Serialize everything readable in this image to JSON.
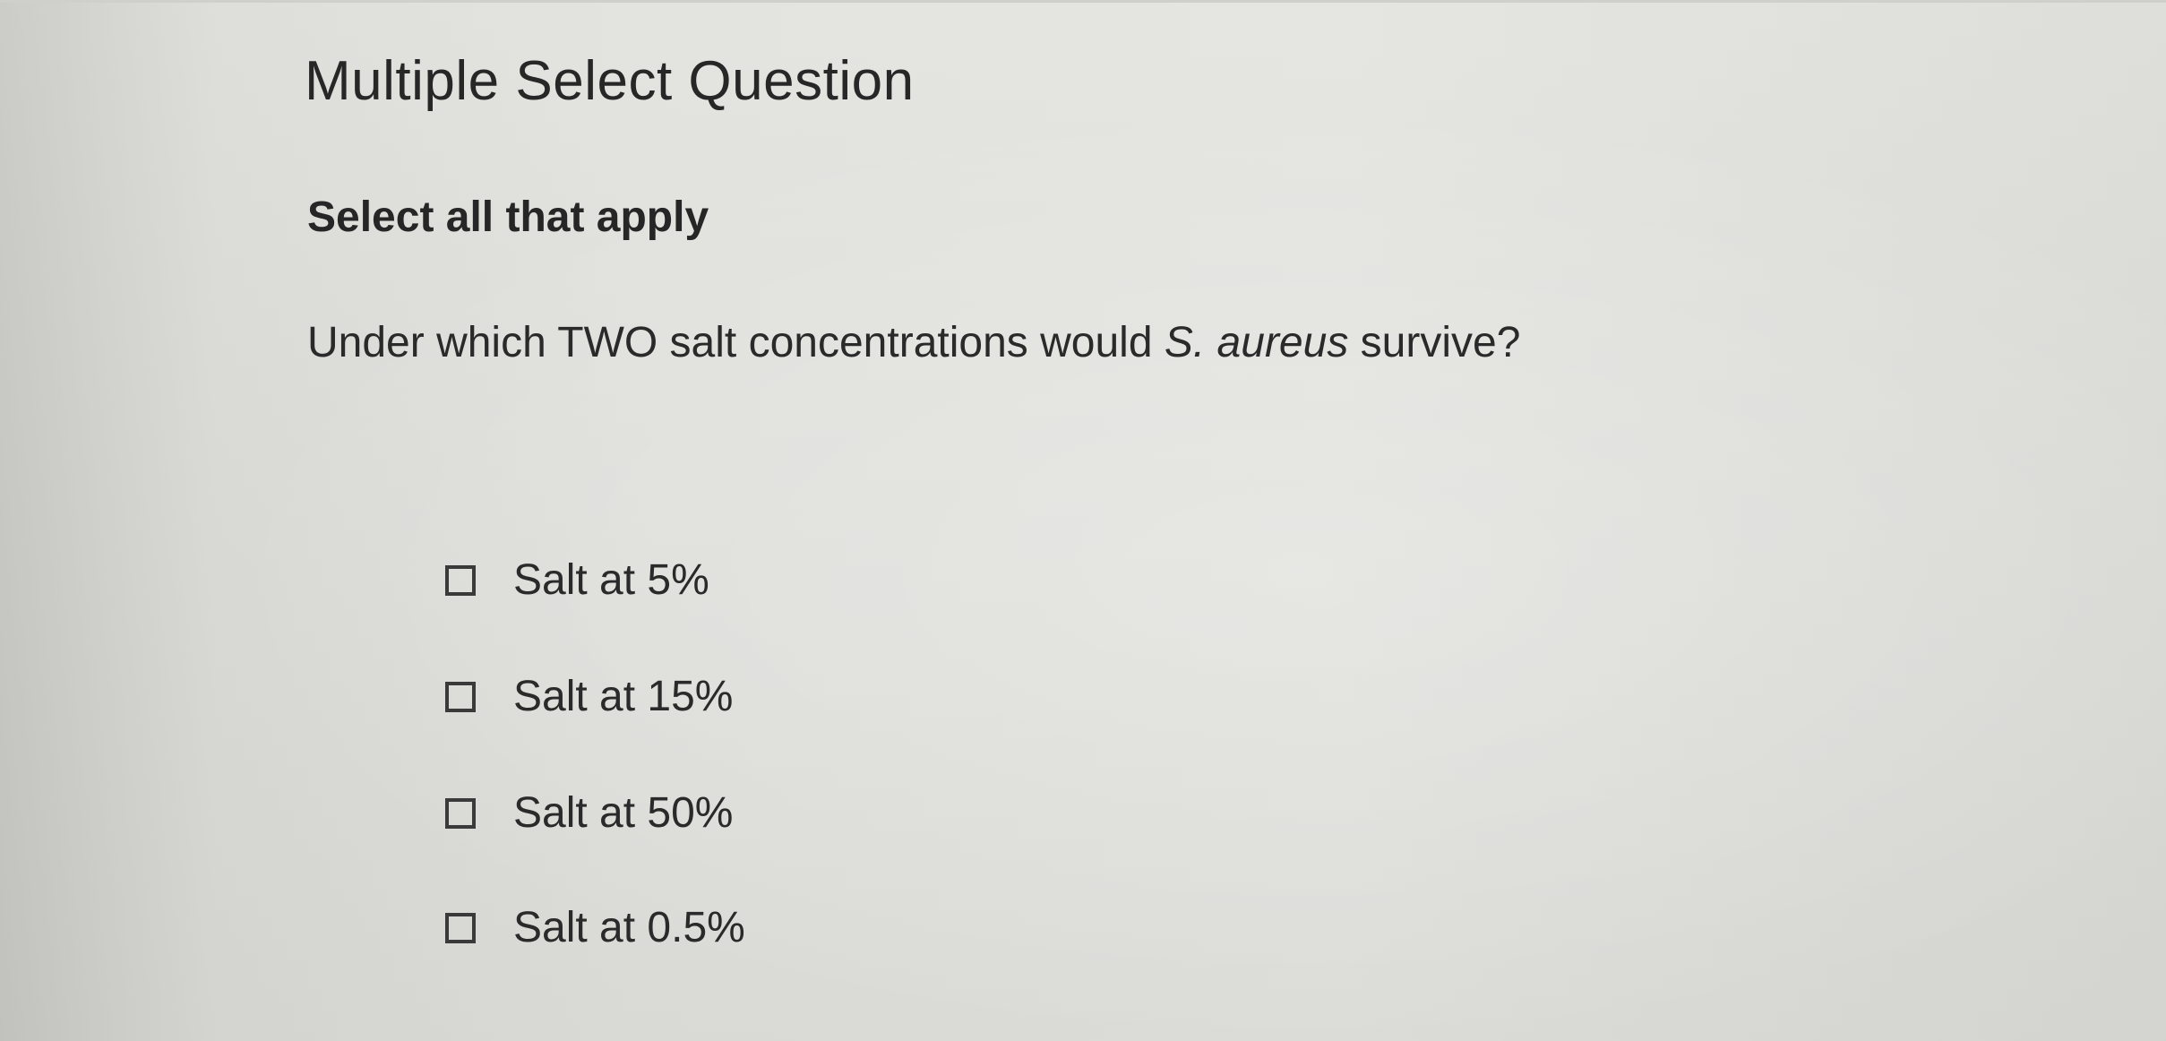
{
  "question": {
    "type_label": "Multiple Select Question",
    "instruction": "Select all that apply",
    "prompt_before": "Under which TWO salt concentrations would ",
    "prompt_species": "S. aureus",
    "prompt_after": " survive?"
  },
  "options": [
    {
      "label": "Salt at 5%",
      "checked": false
    },
    {
      "label": "Salt at 15%",
      "checked": false
    },
    {
      "label": "Salt at 50%",
      "checked": false
    },
    {
      "label": "Salt at 0.5%",
      "checked": false
    }
  ],
  "colors": {
    "text": "#2a2a2a",
    "background": "#e2e2de",
    "checkbox_border": "#3a3a3a"
  }
}
